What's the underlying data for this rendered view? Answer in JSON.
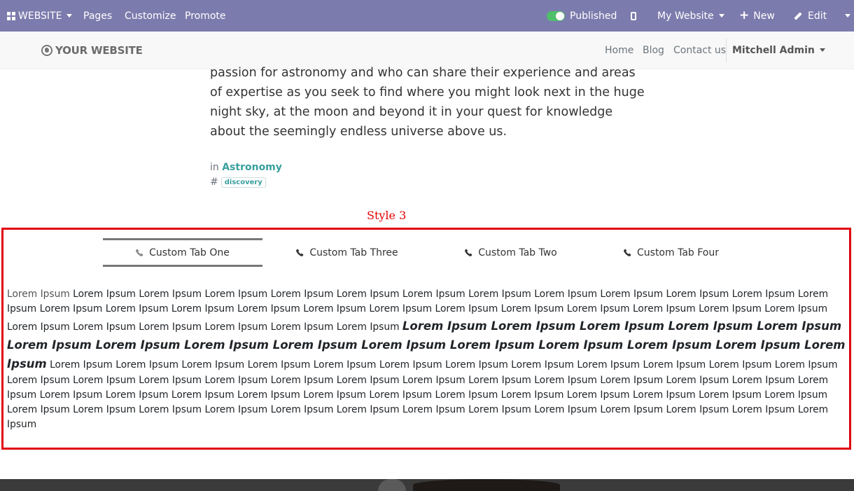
{
  "admin_bar": {
    "website_label": "WEBSITE",
    "menu": [
      "Pages",
      "Customize",
      "Promote"
    ],
    "published_label": "Published",
    "site_selector": "My Website",
    "new_label": "New",
    "edit_label": "Edit"
  },
  "navbar": {
    "logo_text": "YOUR WEBSITE",
    "links": [
      "Home",
      "Blog",
      "Contact us"
    ],
    "user": "Mitchell Admin"
  },
  "article": {
    "text": "passion for astronomy and who can share their experience and areas of expertise as you seek to find where you might look next in the huge night sky, at the moon and beyond it in your quest for knowledge about the seemingly endless universe above us.",
    "category_prefix": "in",
    "category": "Astronomy",
    "tag_prefix": "#",
    "tag": "discovery"
  },
  "style_label": "Style 3",
  "tabs": [
    {
      "label": "Custom Tab One",
      "active": true
    },
    {
      "label": "Custom Tab Three",
      "active": false
    },
    {
      "label": "Custom Tab Two",
      "active": false
    },
    {
      "label": "Custom Tab Four",
      "active": false
    }
  ],
  "tab_content": {
    "lead": "Lorem Ipsum",
    "part1": "Lorem Ipsum Lorem Ipsum Lorem Ipsum Lorem Ipsum Lorem Ipsum Lorem Ipsum Lorem Ipsum Lorem Ipsum Lorem Ipsum Lorem Ipsum Lorem Ipsum Lorem Ipsum Lorem Ipsum Lorem Ipsum Lorem Ipsum Lorem Ipsum Lorem Ipsum Lorem Ipsum Lorem Ipsum Lorem Ipsum Lorem Ipsum Lorem Ipsum Lorem Ipsum Lorem Ipsum Lorem Ipsum Lorem Ipsum Lorem Ipsum Lorem Ipsum Lorem Ipsum Lorem Ipsum",
    "bold": "Lorem Ipsum Lorem Ipsum Lorem Ipsum Lorem Ipsum Lorem Ipsum Lorem Ipsum Lorem Ipsum Lorem Ipsum Lorem Ipsum Lorem Ipsum Lorem Ipsum Lorem Ipsum Lorem Ipsum Lorem Ipsum Lorem Ipsum",
    "part2": "Lorem Ipsum Lorem Ipsum Lorem Ipsum Lorem Ipsum Lorem Ipsum Lorem Ipsum Lorem Ipsum Lorem Ipsum Lorem Ipsum Lorem Ipsum Lorem Ipsum Lorem Ipsum Lorem Ipsum Lorem Ipsum Lorem Ipsum Lorem Ipsum Lorem Ipsum Lorem Ipsum Lorem Ipsum Lorem Ipsum Lorem Ipsum Lorem Ipsum Lorem Ipsum Lorem Ipsum Lorem Ipsum Lorem Ipsum Lorem Ipsum Lorem Ipsum Lorem Ipsum Lorem Ipsum Lorem Ipsum Lorem Ipsum Lorem Ipsum Lorem Ipsum Lorem Ipsum Lorem Ipsum Lorem Ipsum Lorem Ipsum Lorem Ipsum Lorem Ipsum Lorem Ipsum Lorem Ipsum Lorem Ipsum Lorem Ipsum Lorem Ipsum Lorem Ipsum Lorem Ipsum Lorem Ipsum Lorem Ipsum Lorem Ipsum"
  },
  "colors": {
    "admin_bar": "#7c7bad",
    "accent": "#3a9e9e",
    "highlight_border": "#e0000f",
    "toggle_on": "#4fbf6a"
  }
}
